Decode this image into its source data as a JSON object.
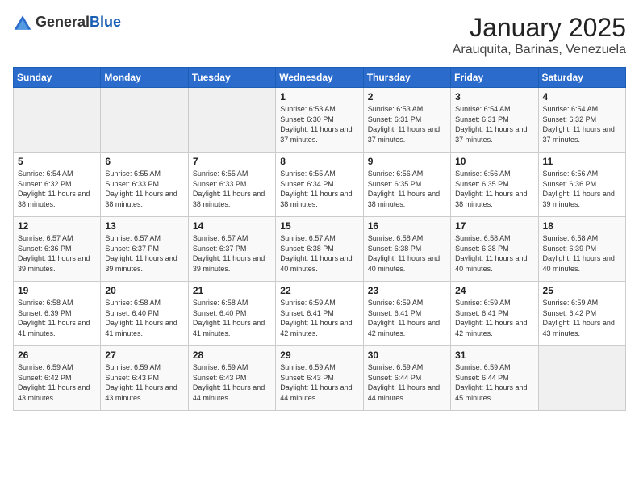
{
  "logo": {
    "general": "General",
    "blue": "Blue"
  },
  "header": {
    "month": "January 2025",
    "location": "Arauquita, Barinas, Venezuela"
  },
  "weekdays": [
    "Sunday",
    "Monday",
    "Tuesday",
    "Wednesday",
    "Thursday",
    "Friday",
    "Saturday"
  ],
  "weeks": [
    [
      {
        "day": "",
        "sunrise": "",
        "sunset": "",
        "daylight": ""
      },
      {
        "day": "",
        "sunrise": "",
        "sunset": "",
        "daylight": ""
      },
      {
        "day": "",
        "sunrise": "",
        "sunset": "",
        "daylight": ""
      },
      {
        "day": "1",
        "sunrise": "Sunrise: 6:53 AM",
        "sunset": "Sunset: 6:30 PM",
        "daylight": "Daylight: 11 hours and 37 minutes."
      },
      {
        "day": "2",
        "sunrise": "Sunrise: 6:53 AM",
        "sunset": "Sunset: 6:31 PM",
        "daylight": "Daylight: 11 hours and 37 minutes."
      },
      {
        "day": "3",
        "sunrise": "Sunrise: 6:54 AM",
        "sunset": "Sunset: 6:31 PM",
        "daylight": "Daylight: 11 hours and 37 minutes."
      },
      {
        "day": "4",
        "sunrise": "Sunrise: 6:54 AM",
        "sunset": "Sunset: 6:32 PM",
        "daylight": "Daylight: 11 hours and 37 minutes."
      }
    ],
    [
      {
        "day": "5",
        "sunrise": "Sunrise: 6:54 AM",
        "sunset": "Sunset: 6:32 PM",
        "daylight": "Daylight: 11 hours and 38 minutes."
      },
      {
        "day": "6",
        "sunrise": "Sunrise: 6:55 AM",
        "sunset": "Sunset: 6:33 PM",
        "daylight": "Daylight: 11 hours and 38 minutes."
      },
      {
        "day": "7",
        "sunrise": "Sunrise: 6:55 AM",
        "sunset": "Sunset: 6:33 PM",
        "daylight": "Daylight: 11 hours and 38 minutes."
      },
      {
        "day": "8",
        "sunrise": "Sunrise: 6:55 AM",
        "sunset": "Sunset: 6:34 PM",
        "daylight": "Daylight: 11 hours and 38 minutes."
      },
      {
        "day": "9",
        "sunrise": "Sunrise: 6:56 AM",
        "sunset": "Sunset: 6:35 PM",
        "daylight": "Daylight: 11 hours and 38 minutes."
      },
      {
        "day": "10",
        "sunrise": "Sunrise: 6:56 AM",
        "sunset": "Sunset: 6:35 PM",
        "daylight": "Daylight: 11 hours and 38 minutes."
      },
      {
        "day": "11",
        "sunrise": "Sunrise: 6:56 AM",
        "sunset": "Sunset: 6:36 PM",
        "daylight": "Daylight: 11 hours and 39 minutes."
      }
    ],
    [
      {
        "day": "12",
        "sunrise": "Sunrise: 6:57 AM",
        "sunset": "Sunset: 6:36 PM",
        "daylight": "Daylight: 11 hours and 39 minutes."
      },
      {
        "day": "13",
        "sunrise": "Sunrise: 6:57 AM",
        "sunset": "Sunset: 6:37 PM",
        "daylight": "Daylight: 11 hours and 39 minutes."
      },
      {
        "day": "14",
        "sunrise": "Sunrise: 6:57 AM",
        "sunset": "Sunset: 6:37 PM",
        "daylight": "Daylight: 11 hours and 39 minutes."
      },
      {
        "day": "15",
        "sunrise": "Sunrise: 6:57 AM",
        "sunset": "Sunset: 6:38 PM",
        "daylight": "Daylight: 11 hours and 40 minutes."
      },
      {
        "day": "16",
        "sunrise": "Sunrise: 6:58 AM",
        "sunset": "Sunset: 6:38 PM",
        "daylight": "Daylight: 11 hours and 40 minutes."
      },
      {
        "day": "17",
        "sunrise": "Sunrise: 6:58 AM",
        "sunset": "Sunset: 6:38 PM",
        "daylight": "Daylight: 11 hours and 40 minutes."
      },
      {
        "day": "18",
        "sunrise": "Sunrise: 6:58 AM",
        "sunset": "Sunset: 6:39 PM",
        "daylight": "Daylight: 11 hours and 40 minutes."
      }
    ],
    [
      {
        "day": "19",
        "sunrise": "Sunrise: 6:58 AM",
        "sunset": "Sunset: 6:39 PM",
        "daylight": "Daylight: 11 hours and 41 minutes."
      },
      {
        "day": "20",
        "sunrise": "Sunrise: 6:58 AM",
        "sunset": "Sunset: 6:40 PM",
        "daylight": "Daylight: 11 hours and 41 minutes."
      },
      {
        "day": "21",
        "sunrise": "Sunrise: 6:58 AM",
        "sunset": "Sunset: 6:40 PM",
        "daylight": "Daylight: 11 hours and 41 minutes."
      },
      {
        "day": "22",
        "sunrise": "Sunrise: 6:59 AM",
        "sunset": "Sunset: 6:41 PM",
        "daylight": "Daylight: 11 hours and 42 minutes."
      },
      {
        "day": "23",
        "sunrise": "Sunrise: 6:59 AM",
        "sunset": "Sunset: 6:41 PM",
        "daylight": "Daylight: 11 hours and 42 minutes."
      },
      {
        "day": "24",
        "sunrise": "Sunrise: 6:59 AM",
        "sunset": "Sunset: 6:41 PM",
        "daylight": "Daylight: 11 hours and 42 minutes."
      },
      {
        "day": "25",
        "sunrise": "Sunrise: 6:59 AM",
        "sunset": "Sunset: 6:42 PM",
        "daylight": "Daylight: 11 hours and 43 minutes."
      }
    ],
    [
      {
        "day": "26",
        "sunrise": "Sunrise: 6:59 AM",
        "sunset": "Sunset: 6:42 PM",
        "daylight": "Daylight: 11 hours and 43 minutes."
      },
      {
        "day": "27",
        "sunrise": "Sunrise: 6:59 AM",
        "sunset": "Sunset: 6:43 PM",
        "daylight": "Daylight: 11 hours and 43 minutes."
      },
      {
        "day": "28",
        "sunrise": "Sunrise: 6:59 AM",
        "sunset": "Sunset: 6:43 PM",
        "daylight": "Daylight: 11 hours and 44 minutes."
      },
      {
        "day": "29",
        "sunrise": "Sunrise: 6:59 AM",
        "sunset": "Sunset: 6:43 PM",
        "daylight": "Daylight: 11 hours and 44 minutes."
      },
      {
        "day": "30",
        "sunrise": "Sunrise: 6:59 AM",
        "sunset": "Sunset: 6:44 PM",
        "daylight": "Daylight: 11 hours and 44 minutes."
      },
      {
        "day": "31",
        "sunrise": "Sunrise: 6:59 AM",
        "sunset": "Sunset: 6:44 PM",
        "daylight": "Daylight: 11 hours and 45 minutes."
      },
      {
        "day": "",
        "sunrise": "",
        "sunset": "",
        "daylight": ""
      }
    ]
  ]
}
